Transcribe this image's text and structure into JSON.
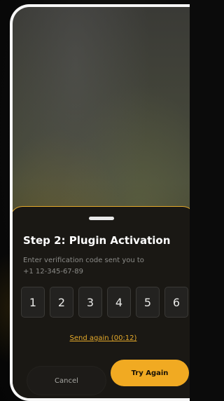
{
  "dialog": {
    "title": "Step 2: Plugin Activation",
    "instruction": "Enter verification code sent you to",
    "phone_number": "+1 12-345-67-89"
  },
  "code_digits": [
    "1",
    "2",
    "3",
    "4",
    "5",
    "6"
  ],
  "resend_label": "Send again (00:12)",
  "actions": {
    "cancel_label": "Cancel",
    "try_again_label": "Try Again"
  },
  "colors": {
    "accent": "#f1aa22",
    "sheet_background": "#1a1814",
    "digit_box": "#232220"
  }
}
